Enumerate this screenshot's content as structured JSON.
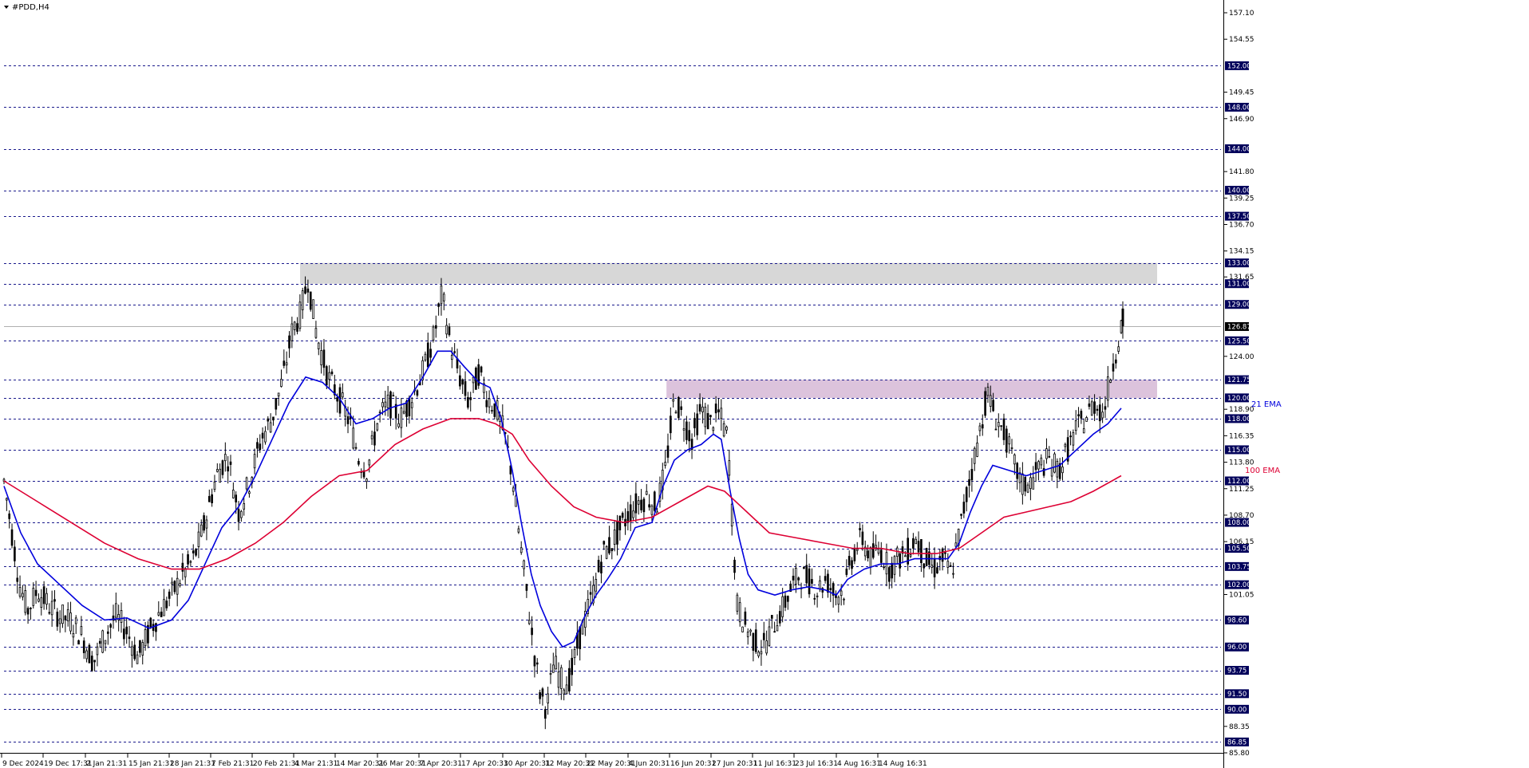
{
  "symbol_title": "#PDD,H4",
  "colors": {
    "background": "#ffffff",
    "grid_level": "#1a1a8c",
    "candle": "#000000",
    "ema21": "#0000dd",
    "ema100": "#dd0033",
    "resistance_zone": "#d3d3d3",
    "breakout_zone": "#d8bcd8",
    "level_tag": "#00005a",
    "price_tag": "#000000"
  },
  "annotations": [
    {
      "text": "21 EMA",
      "color": "#0000dd"
    },
    {
      "text": "100 EMA",
      "color": "#dd0033"
    }
  ],
  "chart_data": {
    "type": "candlestick",
    "title": "#PDD,H4",
    "ylim": [
      85.8,
      158.0
    ],
    "y_ticks": [
      "157.10",
      "154.55",
      "149.45",
      "146.90",
      "141.80",
      "139.25",
      "136.70",
      "134.15",
      "131.65",
      "124.00",
      "118.90",
      "116.35",
      "113.80",
      "111.25",
      "108.70",
      "106.15",
      "101.05",
      "88.35",
      "85.80"
    ],
    "level_lines": [
      152.0,
      148.0,
      144.0,
      140.0,
      137.5,
      133.0,
      131.0,
      129.0,
      125.5,
      121.75,
      120.0,
      118.0,
      115.0,
      112.0,
      108.0,
      105.5,
      103.75,
      102.0,
      98.6,
      96.0,
      93.75,
      91.5,
      90.0,
      86.85
    ],
    "level_labels": [
      "152.00",
      "148.00",
      "144.00",
      "140.00",
      "137.50",
      "133.00",
      "131.00",
      "129.00",
      "125.50",
      "121.75",
      "120.00",
      "118.00",
      "115.00",
      "112.00",
      "108.00",
      "105.50",
      "103.75",
      "102.00",
      "98.60",
      "96.00",
      "93.75",
      "91.50",
      "90.00",
      "86.85"
    ],
    "current_price": 126.87,
    "current_price_label": "126.87",
    "x_labels": [
      "9 Dec 2024",
      "19 Dec 17:31",
      "2 Jan 21:31",
      "15 Jan 21:31",
      "28 Jan 21:31",
      "7 Feb 21:31",
      "20 Feb 21:31",
      "4 Mar 21:31",
      "14 Mar 20:31",
      "26 Mar 20:31",
      "7 Apr 20:31",
      "17 Apr 20:31",
      "30 Apr 20:31",
      "12 May 20:31",
      "22 May 20:31",
      "4 Jun 20:31",
      "16 Jun 20:31",
      "27 Jun 20:31",
      "11 Jul 16:31",
      "23 Jul 16:31",
      "4 Aug 16:31",
      "14 Aug 16:31"
    ],
    "zones": [
      {
        "name": "resistance",
        "from": 131.0,
        "to": 133.0,
        "start_bar": 0.265
      },
      {
        "name": "breakout",
        "from": 120.0,
        "to": 121.75,
        "start_bar": 0.593
      }
    ],
    "price_path": [
      [
        0.0,
        112.0
      ],
      [
        0.007,
        107.0
      ],
      [
        0.014,
        102.0
      ],
      [
        0.021,
        99.5
      ],
      [
        0.03,
        101.5
      ],
      [
        0.04,
        100.0
      ],
      [
        0.05,
        99.0
      ],
      [
        0.06,
        98.5
      ],
      [
        0.07,
        97.0
      ],
      [
        0.08,
        94.5
      ],
      [
        0.09,
        97.0
      ],
      [
        0.1,
        99.0
      ],
      [
        0.11,
        97.5
      ],
      [
        0.12,
        95.0
      ],
      [
        0.13,
        97.5
      ],
      [
        0.14,
        99.5
      ],
      [
        0.15,
        101.0
      ],
      [
        0.16,
        103.0
      ],
      [
        0.17,
        104.5
      ],
      [
        0.18,
        108.0
      ],
      [
        0.19,
        112.5
      ],
      [
        0.2,
        114.5
      ],
      [
        0.21,
        109.0
      ],
      [
        0.22,
        112.0
      ],
      [
        0.23,
        116.0
      ],
      [
        0.24,
        118.0
      ],
      [
        0.25,
        122.0
      ],
      [
        0.258,
        126.5
      ],
      [
        0.265,
        128.0
      ],
      [
        0.272,
        131.5
      ],
      [
        0.28,
        126.0
      ],
      [
        0.29,
        122.0
      ],
      [
        0.3,
        120.0
      ],
      [
        0.31,
        117.5
      ],
      [
        0.318,
        114.0
      ],
      [
        0.325,
        113.0
      ],
      [
        0.335,
        118.0
      ],
      [
        0.345,
        119.5
      ],
      [
        0.355,
        118.0
      ],
      [
        0.365,
        120.0
      ],
      [
        0.375,
        122.5
      ],
      [
        0.385,
        126.0
      ],
      [
        0.392,
        130.0
      ],
      [
        0.4,
        125.0
      ],
      [
        0.408,
        122.0
      ],
      [
        0.416,
        119.5
      ],
      [
        0.425,
        122.5
      ],
      [
        0.433,
        120.0
      ],
      [
        0.44,
        119.0
      ],
      [
        0.448,
        116.5
      ],
      [
        0.455,
        112.5
      ],
      [
        0.462,
        106.0
      ],
      [
        0.468,
        101.0
      ],
      [
        0.474,
        96.0
      ],
      [
        0.48,
        91.5
      ],
      [
        0.486,
        90.0
      ],
      [
        0.492,
        94.5
      ],
      [
        0.5,
        92.5
      ],
      [
        0.507,
        93.0
      ],
      [
        0.514,
        96.5
      ],
      [
        0.521,
        99.0
      ],
      [
        0.528,
        101.5
      ],
      [
        0.536,
        105.0
      ],
      [
        0.544,
        106.0
      ],
      [
        0.552,
        107.5
      ],
      [
        0.56,
        109.0
      ],
      [
        0.568,
        110.0
      ],
      [
        0.576,
        110.5
      ],
      [
        0.584,
        109.5
      ],
      [
        0.592,
        113.0
      ],
      [
        0.6,
        120.0
      ],
      [
        0.608,
        118.0
      ],
      [
        0.616,
        116.0
      ],
      [
        0.624,
        119.0
      ],
      [
        0.632,
        117.5
      ],
      [
        0.64,
        118.5
      ],
      [
        0.648,
        116.0
      ],
      [
        0.656,
        100.0
      ],
      [
        0.664,
        98.0
      ],
      [
        0.672,
        96.5
      ],
      [
        0.68,
        96.0
      ],
      [
        0.688,
        98.0
      ],
      [
        0.696,
        99.5
      ],
      [
        0.704,
        101.5
      ],
      [
        0.712,
        103.0
      ],
      [
        0.72,
        102.5
      ],
      [
        0.728,
        101.5
      ],
      [
        0.736,
        102.5
      ],
      [
        0.744,
        101.0
      ],
      [
        0.752,
        101.5
      ],
      [
        0.76,
        105.0
      ],
      [
        0.768,
        106.5
      ],
      [
        0.776,
        104.5
      ],
      [
        0.784,
        105.5
      ],
      [
        0.792,
        103.5
      ],
      [
        0.8,
        104.5
      ],
      [
        0.808,
        105.0
      ],
      [
        0.816,
        106.5
      ],
      [
        0.824,
        104.5
      ],
      [
        0.832,
        103.5
      ],
      [
        0.84,
        104.5
      ],
      [
        0.848,
        103.0
      ],
      [
        0.856,
        107.5
      ],
      [
        0.864,
        112.0
      ],
      [
        0.872,
        116.0
      ],
      [
        0.88,
        120.5
      ],
      [
        0.888,
        118.0
      ],
      [
        0.896,
        116.5
      ],
      [
        0.904,
        113.5
      ],
      [
        0.912,
        111.5
      ],
      [
        0.92,
        112.0
      ],
      [
        0.928,
        113.5
      ],
      [
        0.936,
        114.0
      ],
      [
        0.944,
        113.0
      ],
      [
        0.952,
        115.0
      ],
      [
        0.96,
        117.0
      ],
      [
        0.968,
        118.0
      ],
      [
        0.976,
        119.5
      ],
      [
        0.984,
        118.5
      ],
      [
        0.991,
        122.5
      ],
      [
        1.0,
        126.9
      ]
    ],
    "series": [
      {
        "name": "21 EMA",
        "values": [
          [
            0.0,
            111.5
          ],
          [
            0.015,
            107.0
          ],
          [
            0.03,
            104.0
          ],
          [
            0.05,
            102.0
          ],
          [
            0.07,
            100.0
          ],
          [
            0.09,
            98.6
          ],
          [
            0.11,
            98.8
          ],
          [
            0.13,
            97.8
          ],
          [
            0.15,
            98.6
          ],
          [
            0.165,
            100.5
          ],
          [
            0.18,
            104.0
          ],
          [
            0.195,
            107.5
          ],
          [
            0.21,
            109.5
          ],
          [
            0.225,
            112.5
          ],
          [
            0.24,
            116.0
          ],
          [
            0.255,
            119.5
          ],
          [
            0.27,
            122.0
          ],
          [
            0.285,
            121.5
          ],
          [
            0.3,
            120.0
          ],
          [
            0.315,
            117.5
          ],
          [
            0.33,
            118.0
          ],
          [
            0.345,
            119.0
          ],
          [
            0.36,
            119.5
          ],
          [
            0.375,
            122.0
          ],
          [
            0.388,
            124.5
          ],
          [
            0.4,
            124.5
          ],
          [
            0.412,
            123.0
          ],
          [
            0.425,
            121.5
          ],
          [
            0.435,
            121.0
          ],
          [
            0.445,
            118.0
          ],
          [
            0.455,
            113.0
          ],
          [
            0.463,
            108.0
          ],
          [
            0.472,
            103.0
          ],
          [
            0.48,
            100.0
          ],
          [
            0.49,
            97.5
          ],
          [
            0.5,
            96.0
          ],
          [
            0.51,
            96.5
          ],
          [
            0.52,
            99.0
          ],
          [
            0.53,
            101.0
          ],
          [
            0.54,
            102.5
          ],
          [
            0.552,
            104.5
          ],
          [
            0.565,
            107.5
          ],
          [
            0.58,
            108.0
          ],
          [
            0.59,
            111.5
          ],
          [
            0.6,
            114.0
          ],
          [
            0.612,
            115.0
          ],
          [
            0.624,
            115.5
          ],
          [
            0.635,
            116.5
          ],
          [
            0.642,
            116.0
          ],
          [
            0.65,
            111.0
          ],
          [
            0.658,
            106.5
          ],
          [
            0.666,
            103.0
          ],
          [
            0.675,
            101.5
          ],
          [
            0.69,
            101.0
          ],
          [
            0.705,
            101.5
          ],
          [
            0.72,
            101.8
          ],
          [
            0.735,
            101.5
          ],
          [
            0.745,
            101.0
          ],
          [
            0.755,
            102.5
          ],
          [
            0.77,
            103.5
          ],
          [
            0.785,
            104.0
          ],
          [
            0.8,
            104.0
          ],
          [
            0.815,
            104.5
          ],
          [
            0.83,
            104.5
          ],
          [
            0.845,
            104.5
          ],
          [
            0.855,
            106.0
          ],
          [
            0.865,
            109.0
          ],
          [
            0.875,
            111.5
          ],
          [
            0.885,
            113.5
          ],
          [
            0.9,
            113.0
          ],
          [
            0.915,
            112.5
          ],
          [
            0.93,
            113.0
          ],
          [
            0.945,
            113.5
          ],
          [
            0.96,
            115.0
          ],
          [
            0.975,
            116.5
          ],
          [
            0.988,
            117.5
          ],
          [
            1.0,
            119.0
          ]
        ]
      },
      {
        "name": "100 EMA",
        "values": [
          [
            0.0,
            112.0
          ],
          [
            0.03,
            110.0
          ],
          [
            0.06,
            108.0
          ],
          [
            0.09,
            106.0
          ],
          [
            0.12,
            104.5
          ],
          [
            0.15,
            103.5
          ],
          [
            0.175,
            103.5
          ],
          [
            0.2,
            104.5
          ],
          [
            0.225,
            106.0
          ],
          [
            0.25,
            108.0
          ],
          [
            0.275,
            110.5
          ],
          [
            0.3,
            112.5
          ],
          [
            0.325,
            113.0
          ],
          [
            0.35,
            115.5
          ],
          [
            0.375,
            117.0
          ],
          [
            0.4,
            118.0
          ],
          [
            0.425,
            118.0
          ],
          [
            0.44,
            117.5
          ],
          [
            0.455,
            116.5
          ],
          [
            0.47,
            114.0
          ],
          [
            0.49,
            111.5
          ],
          [
            0.51,
            109.5
          ],
          [
            0.53,
            108.5
          ],
          [
            0.555,
            108.0
          ],
          [
            0.58,
            108.5
          ],
          [
            0.605,
            110.0
          ],
          [
            0.63,
            111.5
          ],
          [
            0.645,
            111.0
          ],
          [
            0.665,
            109.0
          ],
          [
            0.685,
            107.0
          ],
          [
            0.71,
            106.5
          ],
          [
            0.735,
            106.0
          ],
          [
            0.76,
            105.5
          ],
          [
            0.785,
            105.5
          ],
          [
            0.81,
            105.0
          ],
          [
            0.835,
            105.0
          ],
          [
            0.855,
            105.5
          ],
          [
            0.875,
            107.0
          ],
          [
            0.895,
            108.5
          ],
          [
            0.915,
            109.0
          ],
          [
            0.935,
            109.5
          ],
          [
            0.955,
            110.0
          ],
          [
            0.975,
            111.0
          ],
          [
            1.0,
            112.5
          ]
        ]
      }
    ]
  }
}
